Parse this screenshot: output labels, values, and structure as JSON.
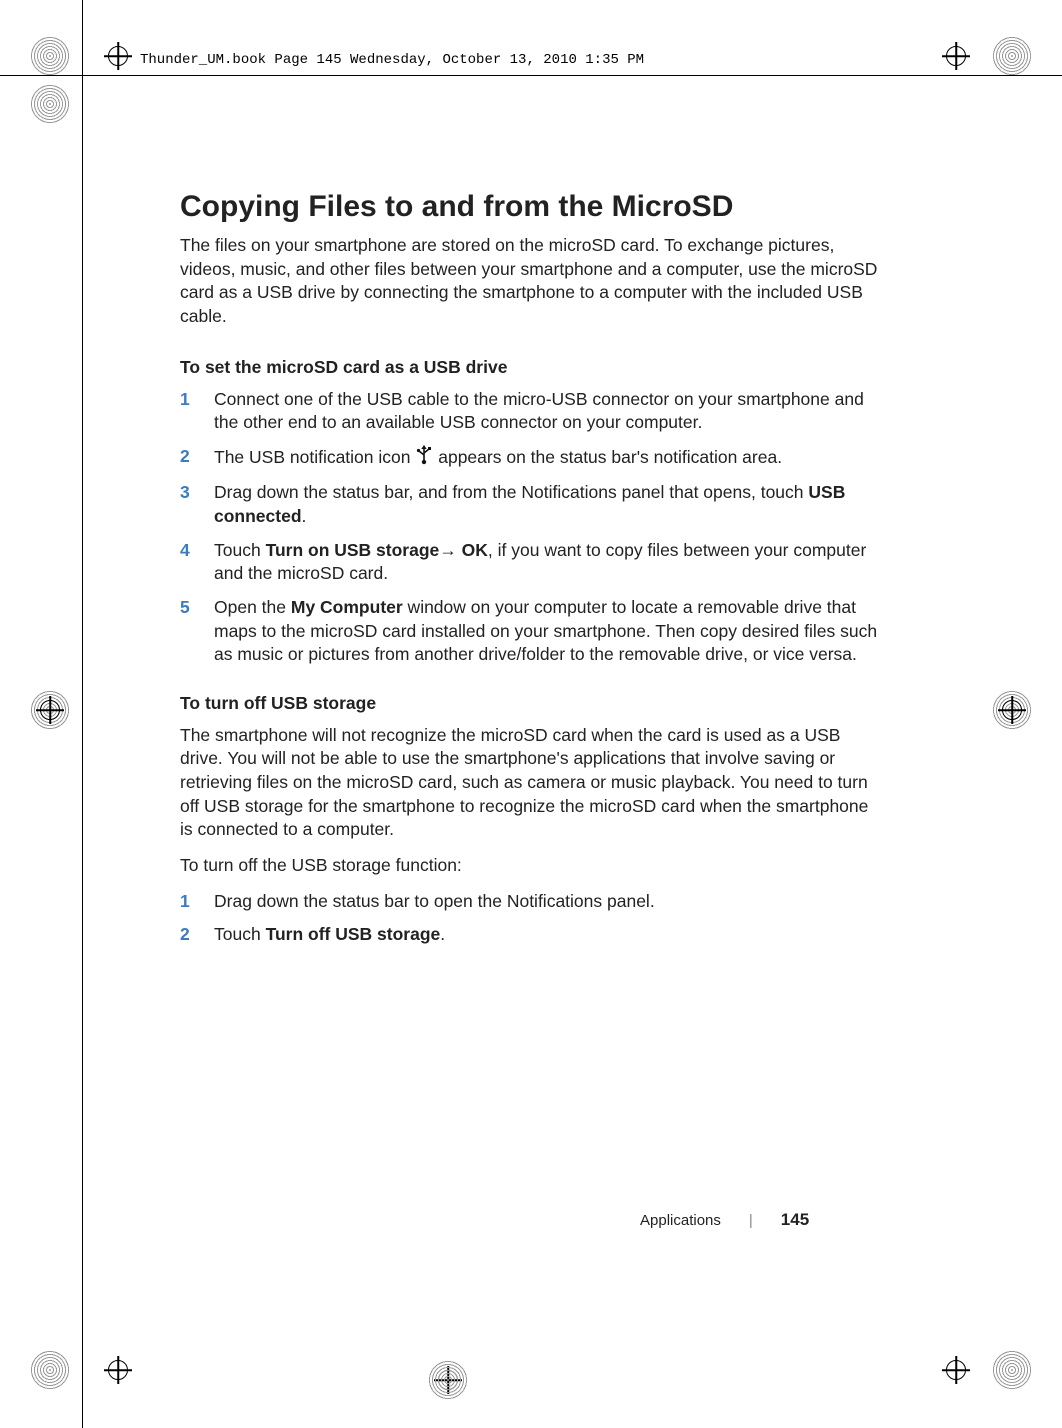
{
  "header_line": "Thunder_UM.book  Page 145  Wednesday, October 13, 2010  1:35 PM",
  "title": "Copying Files to and from the MicroSD",
  "intro": "The files on your smartphone are stored on the microSD card. To exchange pictures, videos, music, and other files between your smartphone and a computer, use the microSD card as a USB drive by connecting the smartphone to a computer with the included USB cable.",
  "section1_head": "To set the microSD card as a USB drive",
  "steps1": {
    "n1": "1",
    "t1": "Connect one of the USB cable to the micro-USB connector on your smartphone and the other end to an available USB connector on your computer.",
    "n2": "2",
    "t2a": "The USB notification icon ",
    "t2b": " appears on the status bar's notification area.",
    "n3": "3",
    "t3a": "Drag down the status bar, and from the Notifications panel that opens, touch ",
    "t3b": "USB connected",
    "t3c": ".",
    "n4": "4",
    "t4a": "Touch ",
    "t4b": "Turn on USB storage",
    "t4c": "→ ",
    "t4d": "OK",
    "t4e": ", if you want to copy files between your computer and the microSD card.",
    "n5": "5",
    "t5a": "Open the ",
    "t5b": "My Computer",
    "t5c": " window on your computer to locate a removable drive that maps to the microSD card installed on your smartphone. Then copy desired files such as music or pictures from another drive/folder to the removable drive, or vice versa."
  },
  "section2_head": "To turn off USB storage",
  "section2_para1": "The smartphone will not recognize the microSD card when the card is used as a USB drive. You will not be able to use the smartphone's applications that involve saving or retrieving files on the microSD card, such as camera or music playback. You need to turn off USB storage for the smartphone to recognize the microSD card when the smartphone is connected to a computer.",
  "section2_para2": "To turn off the USB storage function:",
  "steps2": {
    "n1": "1",
    "t1": "Drag down the status bar to open the Notifications panel.",
    "n2": "2",
    "t2a": "Touch ",
    "t2b": "Turn off USB storage",
    "t2c": "."
  },
  "footer_label": "Applications",
  "page_number": "145"
}
